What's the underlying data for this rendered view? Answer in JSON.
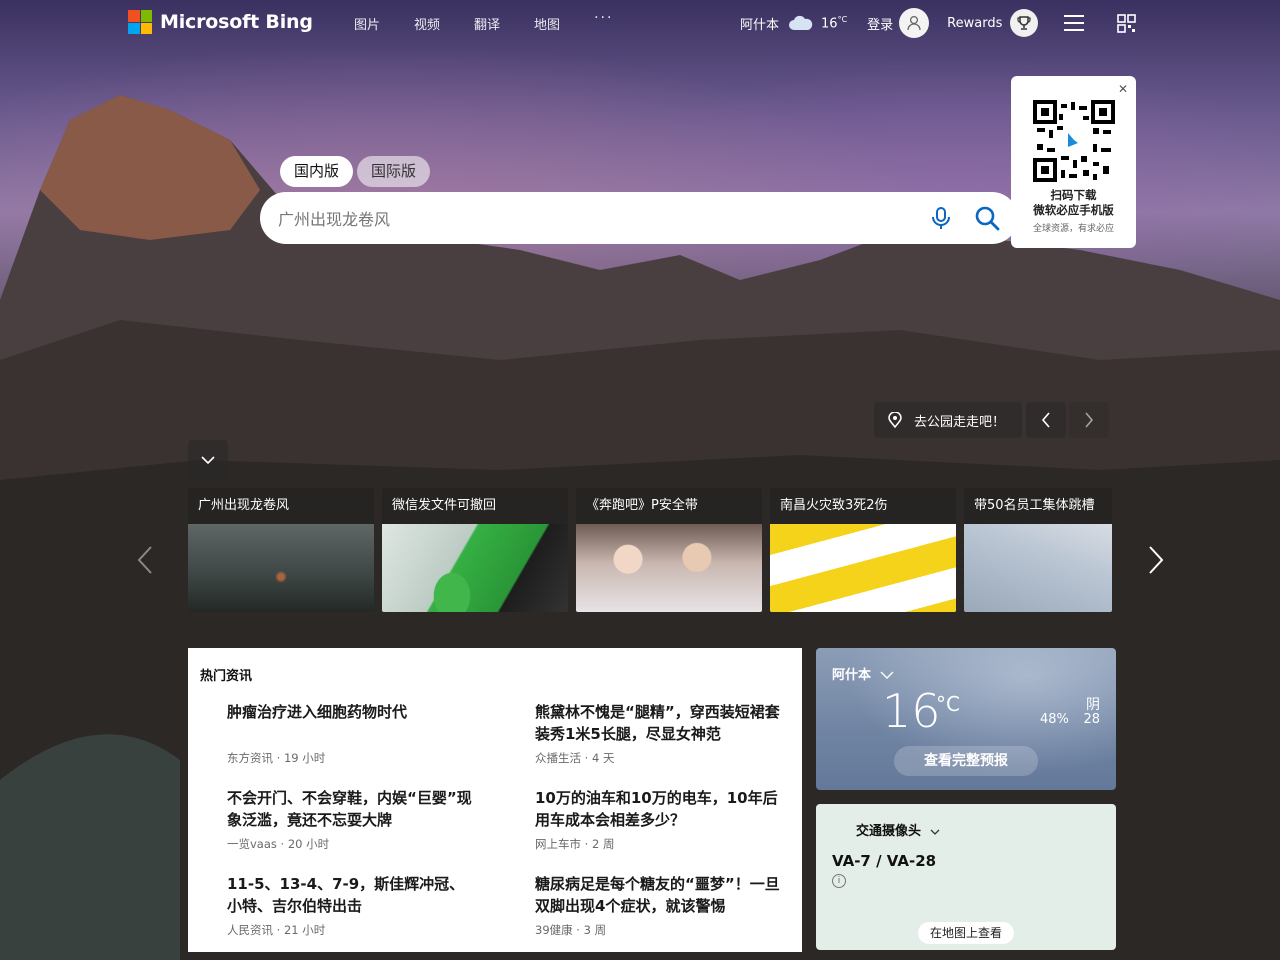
{
  "brand": {
    "name": "Microsoft Bing"
  },
  "nav": {
    "items": [
      "图片",
      "视频",
      "翻译",
      "地图"
    ],
    "more": "···"
  },
  "top": {
    "city": "阿什本",
    "temperature": "16",
    "temp_unit": "°C",
    "login": "登录",
    "rewards": "Rewards"
  },
  "search": {
    "tabs": [
      {
        "label": "国内版",
        "active": true
      },
      {
        "label": "国际版",
        "active": false
      }
    ],
    "placeholder": "广州出现龙卷风"
  },
  "qr_popup": {
    "line1": "扫码下载",
    "line2": "微软必应手机版",
    "line3": "全球资源，有求必应"
  },
  "image_info": {
    "caption": "去公园走走吧！"
  },
  "carousel": [
    {
      "title": "广州出现龙卷风"
    },
    {
      "title": "微信发文件可撤回"
    },
    {
      "title": "《奔跑吧》P安全带"
    },
    {
      "title": "南昌火灾致3死2伤"
    },
    {
      "title": "带50名员工集体跳槽"
    }
  ],
  "news": {
    "heading": "热门资讯",
    "items": [
      {
        "title": "肿瘤治疗进入细胞药物时代",
        "source": "东方资讯 · 19 小时"
      },
      {
        "title": "熊黛林不愧是“腿精”，穿西装短裙套装秀1米5长腿，尽显女神范",
        "source": "众播生活 · 4 天"
      },
      {
        "title": "不会开门、不会穿鞋，内娱“巨婴”现象泛滥，竟还不忘耍大牌",
        "source": "一览vaas · 20 小时"
      },
      {
        "title": "10万的油车和10万的电车，10年后用车成本会相差多少？",
        "source": "网上车市 · 2 周"
      },
      {
        "title": "11-5、13-4、7-9，斯佳辉冲冠、小特、吉尔伯特出击",
        "source": "人民资讯 · 21 小时"
      },
      {
        "title": "糖尿病足是每个糖友的“噩梦”！一旦双脚出现4个症状，就该警惕",
        "source": "39健康 · 3 周"
      }
    ]
  },
  "weather": {
    "city": "阿什本",
    "temperature": "16",
    "unit": "°C",
    "condition": "阴",
    "humidity": "48%",
    "aqi": "28",
    "button": "查看完整预报"
  },
  "traffic": {
    "heading": "交通摄像头",
    "route": "VA-7 / VA-28",
    "info": "i",
    "map_button": "在地图上查看"
  },
  "colors": {
    "logo": [
      "#f25022",
      "#7fba00",
      "#00a4ef",
      "#ffb900"
    ],
    "search_icon": "#0a66c2"
  }
}
